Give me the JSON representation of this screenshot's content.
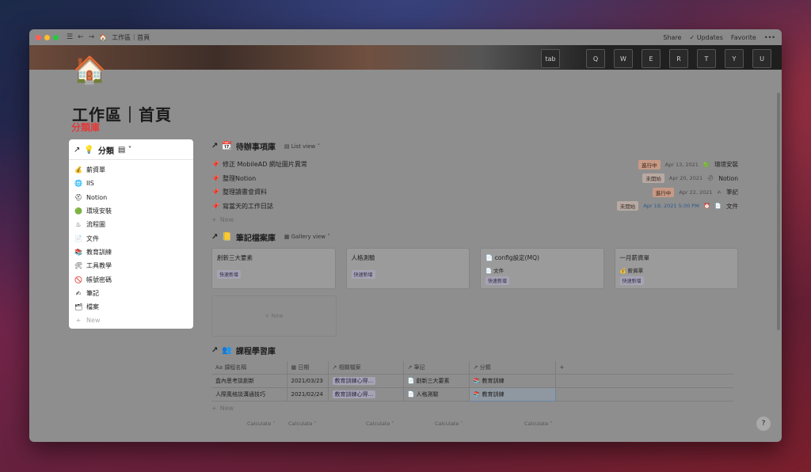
{
  "window": {
    "breadcrumb": "工作區｜首頁",
    "share": "Share",
    "updates": "Updates",
    "favorite": "Favorite",
    "more": "•••",
    "traffic_colors": [
      "#ff5f57",
      "#febc2e",
      "#28c840"
    ]
  },
  "banner": {
    "keys": [
      "Q",
      "W",
      "E",
      "R",
      "T",
      "Y",
      "U"
    ],
    "tab_key": "tab"
  },
  "page": {
    "emoji": "🏠",
    "title": "工作區｜首頁",
    "annotation": "分類庫"
  },
  "category_db": {
    "title": "分類",
    "items": [
      {
        "icon": "💰",
        "label": "薪資單"
      },
      {
        "icon": "🌐",
        "label": "IIS"
      },
      {
        "icon": "⛑",
        "label": "Notion"
      },
      {
        "icon": "🟢",
        "label": "環境安裝"
      },
      {
        "icon": "♨",
        "label": "流程圖"
      },
      {
        "icon": "📄",
        "label": "文件"
      },
      {
        "icon": "📚",
        "label": "教育訓練"
      },
      {
        "icon": "🛠",
        "label": "工具教學"
      },
      {
        "icon": "🚫",
        "label": "帳號密碼"
      },
      {
        "icon": "✍",
        "label": "筆記"
      },
      {
        "icon": "🗂",
        "label": "檔案"
      }
    ],
    "new_label": "New"
  },
  "todo_db": {
    "title": "待辦事項庫",
    "view": "List view",
    "rows": [
      {
        "title": "修正 MobileAD 網址圖片異常",
        "status": "進行中",
        "status_type": "prog",
        "date": "Apr 13, 2021",
        "cat_icon": "🟢",
        "cat": "環境安裝"
      },
      {
        "title": "整理Notion",
        "status": "未開始",
        "status_type": "todo",
        "date": "Apr 20, 2021",
        "cat_icon": "⛑",
        "cat": "Notion"
      },
      {
        "title": "整理讀書會資料",
        "status": "進行中",
        "status_type": "prog",
        "date": "Apr 22, 2021",
        "cat_icon": "✍",
        "cat": "筆記"
      },
      {
        "title": "寫當天的工作日誌",
        "status": "未開始",
        "status_type": "todo",
        "date": "Apr 19, 2021 5:00 PM",
        "date_blue": true,
        "cat_icon": "📄",
        "cat": "文件"
      }
    ],
    "new_label": "New"
  },
  "notes_db": {
    "title": "筆記檔案庫",
    "view": "Gallery view",
    "cards": [
      {
        "title": "創新三大要素",
        "sub": "",
        "tag": "快速新增"
      },
      {
        "title": "人格測驗",
        "sub": "",
        "tag": "快速新增"
      },
      {
        "title": "config設定(MQ)",
        "sub": "文件",
        "tag": "快速新增"
      },
      {
        "title": "一月薪資單",
        "sub": "薪資單",
        "tag": "快速新增"
      }
    ],
    "new_label": "New"
  },
  "course_db": {
    "title": "課程學習庫",
    "headers": [
      "課程名稱",
      "日期",
      "相關檔案",
      "筆記",
      "分類",
      "+"
    ],
    "rows": [
      {
        "name": "盒內思考談創新",
        "date": "2021/03/23",
        "file": "教育訓練心得...",
        "note": "創新三大要素",
        "cat": "教育訓練"
      },
      {
        "name": "人際風格談溝通技巧",
        "date": "2021/02/24",
        "file": "教育訓練心得...",
        "note": "人格測驗",
        "cat": "教育訓練"
      }
    ],
    "new_label": "New",
    "calculate": "Calculate"
  },
  "help": "?"
}
